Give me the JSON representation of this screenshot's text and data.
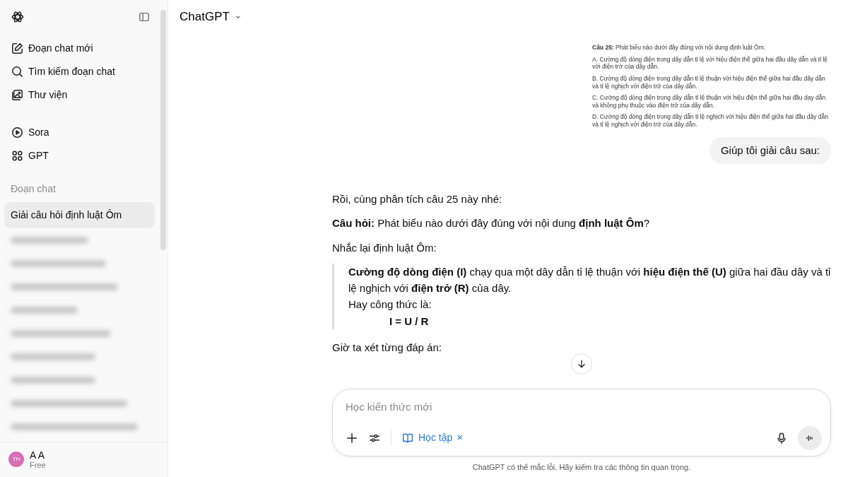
{
  "sidebar": {
    "nav": [
      {
        "label": "Đoạn chat mới"
      },
      {
        "label": "Tìm kiếm đoạn chat"
      },
      {
        "label": "Thư viện"
      }
    ],
    "apps": [
      {
        "label": "Sora"
      },
      {
        "label": "GPT"
      }
    ],
    "section_title": "Đoạn chat",
    "chats": [
      {
        "title": "Giải câu hỏi định luật Ôm",
        "selected": true
      }
    ],
    "blurred_chats": [
      {
        "kind": "blurred"
      },
      {
        "kind": "blurred"
      },
      {
        "kind": "blurred"
      },
      {
        "kind": "blurred"
      },
      {
        "kind": "blurred"
      },
      {
        "kind": "blurred"
      },
      {
        "kind": "blurred"
      },
      {
        "kind": "blurred"
      },
      {
        "kind": "blurred"
      }
    ],
    "user": {
      "initials": "TH",
      "name": "A A",
      "plan": "Free"
    }
  },
  "header": {
    "title": "ChatGPT",
    "caret": "⌄"
  },
  "attachment": {
    "lines": [
      "**Câu 25:** Phát biểu nào dưới đây đúng với nội dung định luật Ôm.",
      "A. Cường độ dòng điện trong dây dẫn tỉ lệ với hiệu điện thế giữa hai đầu dây dẫn và tỉ lệ với điện trở của dây dẫn.",
      "B. Cường độ dòng điện trong dây dẫn tỉ lệ thuận với hiệu điện thế giữa hai đầu dây dẫn và tỉ lệ nghịch với điện trở của dây dẫn.",
      "C. Cường độ dòng điện trong dây dẫn tỉ lệ thuận với hiệu điện thế giữa hai đầu day dẫn và không phụ thuộc vào điện trở của dây dẫn.",
      "D. Cường độ dòng điện trong dây dẫn tỉ lệ nghịch với hiệu điện thế giữa hai đầu dây dẫn và tỉ lệ nghịch với điện trở của dây dẫn."
    ]
  },
  "user_message": "Giúp tôi giải câu sau:",
  "answer": [
    {
      "kind": "paragraph",
      "text": "Rồi, cùng phân tích câu 25 này nhé:"
    },
    {
      "kind": "paragraph",
      "text": "**Câu hỏi:** Phát biểu nào dưới đây đúng với nội dung **định luật Ôm**?"
    },
    {
      "kind": "paragraph",
      "text": "Nhắc lại định luật Ôm:"
    },
    {
      "kind": "quote",
      "lines": [
        {
          "kind": "text",
          "text": "**Cường độ dòng điện (I)** chạy qua một dây dẫn tỉ lệ thuận với **hiệu điện thế (U)** giữa hai đầu dây và tỉ lệ nghịch với **điện trở (R)** của dây."
        },
        {
          "kind": "text",
          "text": "Hay công thức là:"
        },
        {
          "kind": "formula",
          "text": "I = U / R"
        }
      ]
    },
    {
      "kind": "paragraph",
      "text": "Giờ ta xét từng đáp án:"
    }
  ],
  "composer": {
    "placeholder": "Học kiến thức mới",
    "tool": {
      "label": "Học tập",
      "remove": "×"
    }
  },
  "disclaimer": "ChatGPT có thể mắc lỗi. Hãy kiểm tra các thông tin quan trọng."
}
